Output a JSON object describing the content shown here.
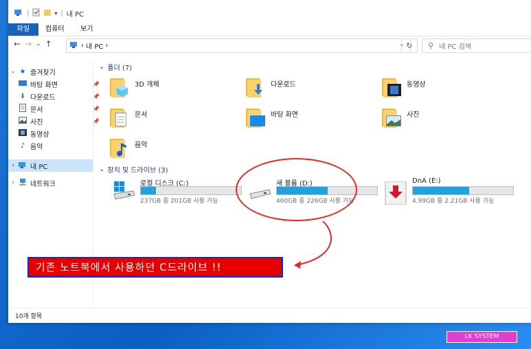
{
  "window": {
    "title": "내 PC",
    "ribbon_tabs": [
      "파일",
      "컴퓨터",
      "보기"
    ],
    "address": {
      "path": [
        "내 PC"
      ],
      "search_placeholder": "내 PC 검색"
    }
  },
  "sidebar": {
    "favorites_label": "즐겨찾기",
    "items": [
      {
        "label": "바탕 화면",
        "icon": "desktop-icon",
        "pinned": true
      },
      {
        "label": "다운로드",
        "icon": "download-icon",
        "pinned": true
      },
      {
        "label": "문서",
        "icon": "document-icon",
        "pinned": true
      },
      {
        "label": "사진",
        "icon": "pictures-icon",
        "pinned": true
      },
      {
        "label": "동영상",
        "icon": "video-icon",
        "pinned": false
      },
      {
        "label": "음악",
        "icon": "music-icon",
        "pinned": false
      }
    ],
    "this_pc_label": "내 PC",
    "network_label": "네트워크"
  },
  "folders_group": {
    "header": "폴더 (7)",
    "items": [
      "3D 개체",
      "다운로드",
      "동영상",
      "문서",
      "바탕 화면",
      "사진",
      "음악"
    ]
  },
  "drives_group": {
    "header": "장치 및 드라이브 (3)",
    "drives": [
      {
        "name": "로컬 디스크 (C:)",
        "free_text": "237GB 중 201GB 사용 가능",
        "used_fraction": 0.15
      },
      {
        "name": "새 볼륨 (D:)",
        "free_text": "460GB 중 226GB 사용 가능",
        "used_fraction": 0.51
      },
      {
        "name": "DnA (E:)",
        "free_text": "4.99GB 중 2.21GB 사용 가능",
        "used_fraction": 0.56
      }
    ]
  },
  "status_bar": {
    "count": "10개 항목"
  },
  "annotation": {
    "text": "기존 노트북에서 사용하던 C드라이브 !!"
  },
  "logo": {
    "text": "LK SYSTEM"
  },
  "colors": {
    "accent": "#1a62b8",
    "bar_fill": "#26a0da",
    "annotation_red": "#e60000"
  }
}
